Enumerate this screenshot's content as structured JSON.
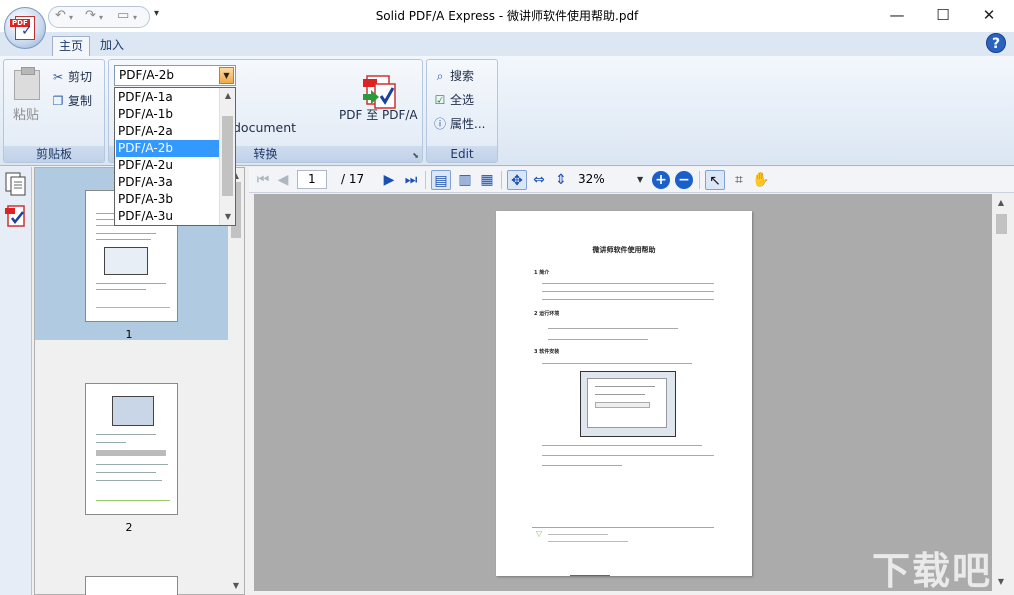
{
  "window": {
    "title": "Solid PDF/A Express - 微讲师软件使用帮助.pdf",
    "minimize": "—",
    "maximize": "☐",
    "close": "✕"
  },
  "app_button": {
    "badge": "PDF"
  },
  "quick_access": {
    "undo": "↶",
    "redo": "↷",
    "save": "▭",
    "more": "▾"
  },
  "tabs": [
    {
      "label": "主页",
      "active": true
    },
    {
      "label": "加入",
      "active": false
    }
  ],
  "help_label": "?",
  "clipboard": {
    "group_label": "剪贴板",
    "paste": "粘贴",
    "cut": "剪切",
    "copy": "复制"
  },
  "convert": {
    "group_label": "转换",
    "combo_value": "PDF/A-2b",
    "button_label": "PDF 至 PDF/A",
    "doc_label": "document",
    "options": [
      "PDF/A-1a",
      "PDF/A-1b",
      "PDF/A-2a",
      "PDF/A-2b",
      "PDF/A-2u",
      "PDF/A-3a",
      "PDF/A-3b",
      "PDF/A-3u"
    ],
    "selected_option": "PDF/A-2b"
  },
  "edit": {
    "group_label": "Edit",
    "search": "搜索",
    "select_all": "全选",
    "properties": "属性..."
  },
  "thumbnails": {
    "pages": [
      {
        "number": "1"
      },
      {
        "number": "2"
      }
    ]
  },
  "doc_toolbar": {
    "current_page": "1",
    "total_pages": "/ 17",
    "zoom": "32%"
  },
  "page_content": {
    "title": "微讲师软件使用帮助",
    "s1": "1  简介",
    "s2": "2  运行环境",
    "s3": "3  软件安装",
    "footer": "▽"
  },
  "watermark": "下载吧"
}
